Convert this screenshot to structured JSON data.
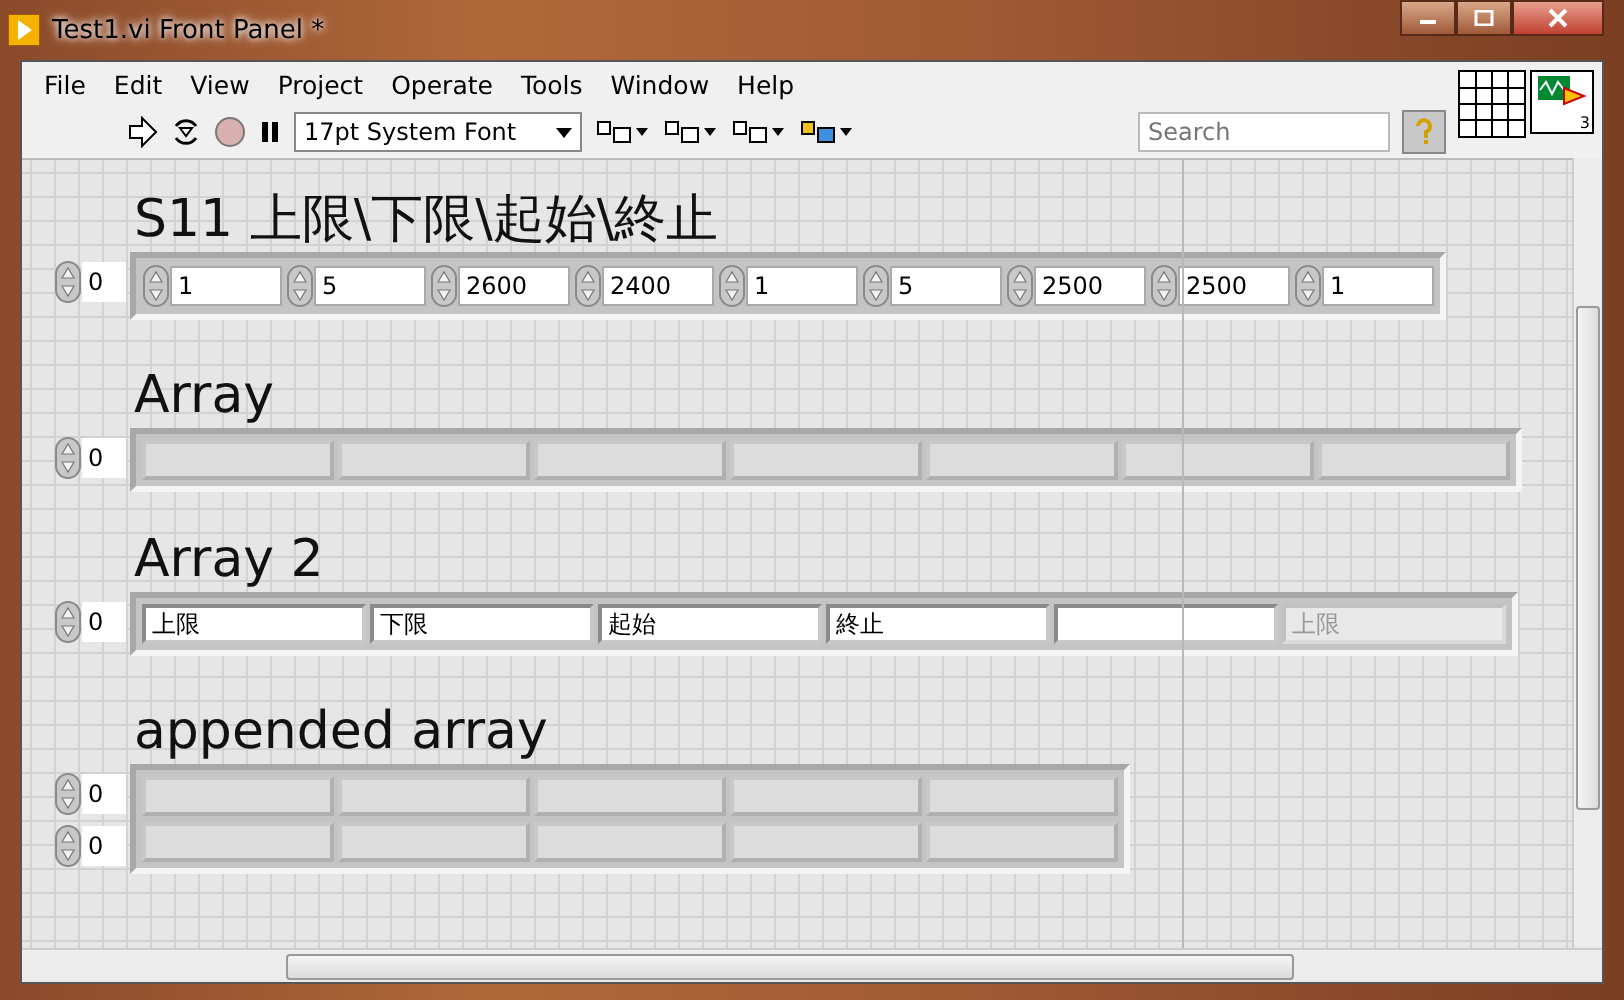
{
  "window": {
    "title": "Test1.vi Front Panel *"
  },
  "menu": [
    "File",
    "Edit",
    "View",
    "Project",
    "Operate",
    "Tools",
    "Window",
    "Help"
  ],
  "toolbar": {
    "font": "17pt System Font",
    "search": {
      "placeholder": "Search"
    }
  },
  "connector": {
    "terminal_count": "3"
  },
  "arrays": [
    {
      "label": "S11  上限\\下限\\起始\\終止",
      "indices": [
        "0"
      ],
      "rows": [
        [
          {
            "kind": "numeric",
            "value": "1"
          },
          {
            "kind": "numeric",
            "value": "5"
          },
          {
            "kind": "numeric",
            "value": "2600"
          },
          {
            "kind": "numeric",
            "value": "2400"
          },
          {
            "kind": "numeric",
            "value": "1"
          },
          {
            "kind": "numeric",
            "value": "5"
          },
          {
            "kind": "numeric",
            "value": "2500"
          },
          {
            "kind": "numeric",
            "value": "2500"
          },
          {
            "kind": "numeric",
            "value": "1"
          }
        ]
      ]
    },
    {
      "label": "Array",
      "indices": [
        "0"
      ],
      "rows": [
        [
          {
            "kind": "empty"
          },
          {
            "kind": "empty"
          },
          {
            "kind": "empty"
          },
          {
            "kind": "empty"
          },
          {
            "kind": "empty"
          },
          {
            "kind": "empty"
          },
          {
            "kind": "empty"
          }
        ]
      ]
    },
    {
      "label": "Array 2",
      "indices": [
        "0"
      ],
      "rows": [
        [
          {
            "kind": "string",
            "value": "上限",
            "disabled": false
          },
          {
            "kind": "string",
            "value": "下限",
            "disabled": false
          },
          {
            "kind": "string",
            "value": "起始",
            "disabled": false
          },
          {
            "kind": "string",
            "value": "終止",
            "disabled": false
          },
          {
            "kind": "string",
            "disabled": false
          },
          {
            "kind": "string",
            "value": "上限",
            "disabled": true
          }
        ]
      ]
    },
    {
      "label": "appended array",
      "indices": [
        "0",
        "0"
      ],
      "rows": [
        [
          {
            "kind": "empty"
          },
          {
            "kind": "empty"
          },
          {
            "kind": "empty"
          },
          {
            "kind": "empty"
          },
          {
            "kind": "empty"
          }
        ],
        [
          {
            "kind": "empty"
          },
          {
            "kind": "empty"
          },
          {
            "kind": "empty"
          },
          {
            "kind": "empty"
          },
          {
            "kind": "empty"
          }
        ]
      ]
    }
  ]
}
